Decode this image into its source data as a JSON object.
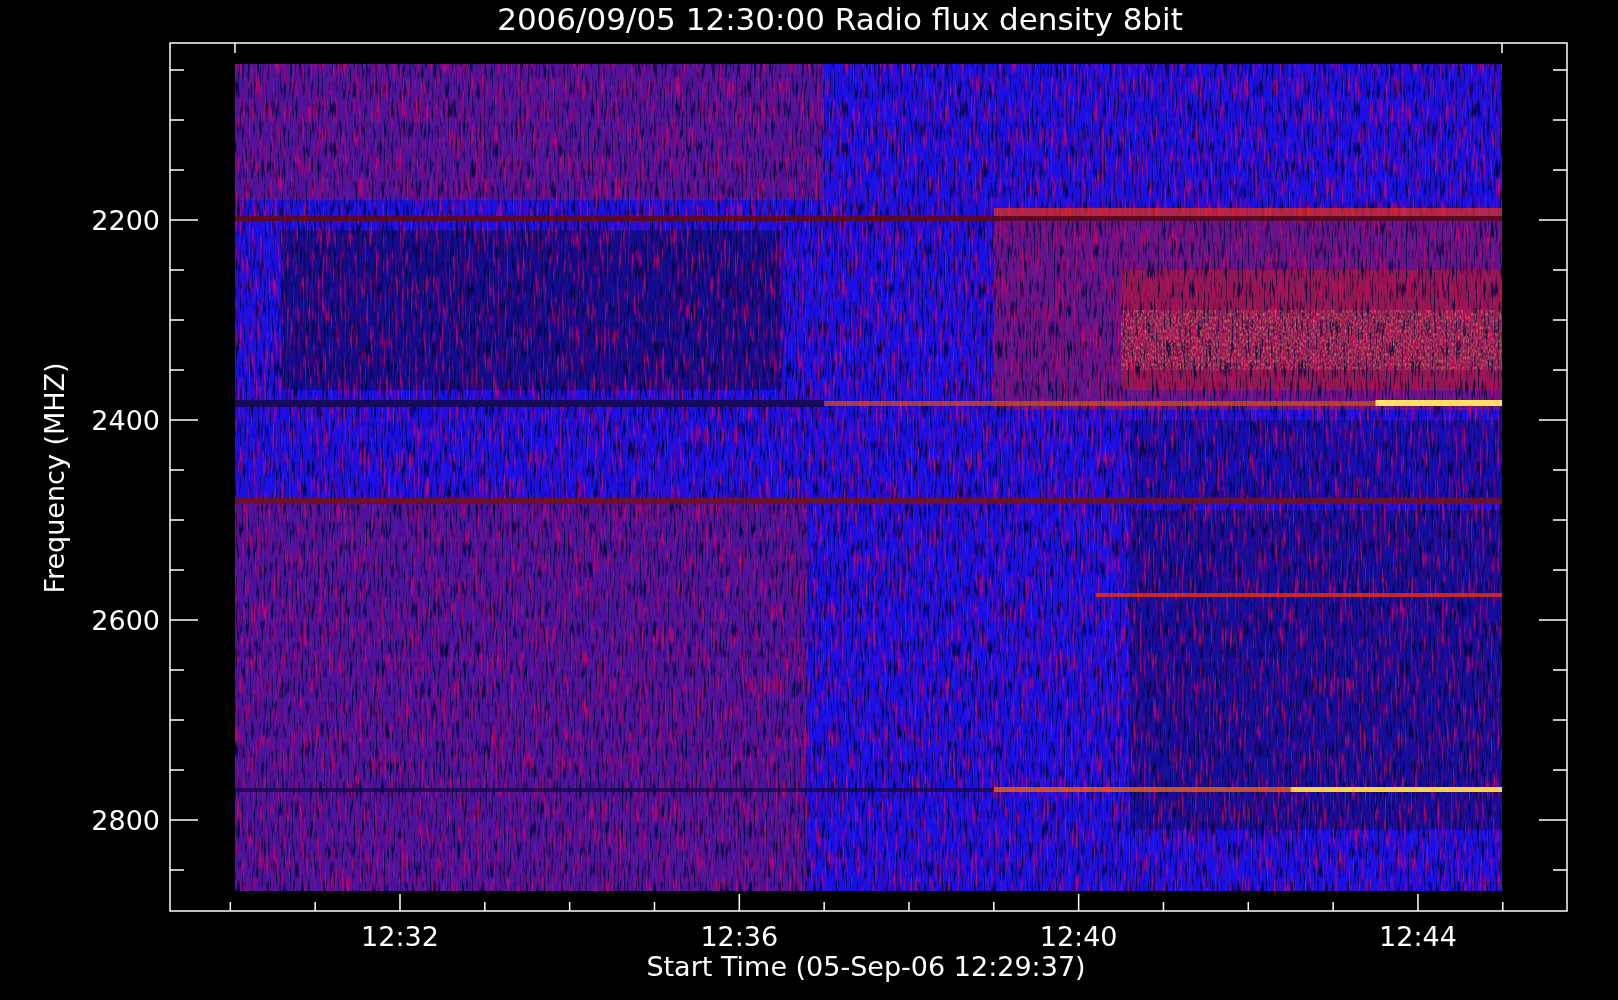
{
  "plot": {
    "title": "2006/09/05 12:30:00 Radio flux density 8bit",
    "x_axis": {
      "label": "Start Time (05-Sep-06 12:29:37)",
      "ticks": [
        "12:32",
        "12:36",
        "12:40",
        "12:44"
      ]
    },
    "y_axis": {
      "label": "Frequency (MHZ)",
      "ticks": [
        "2200",
        "2400",
        "2600",
        "2800"
      ]
    }
  }
}
